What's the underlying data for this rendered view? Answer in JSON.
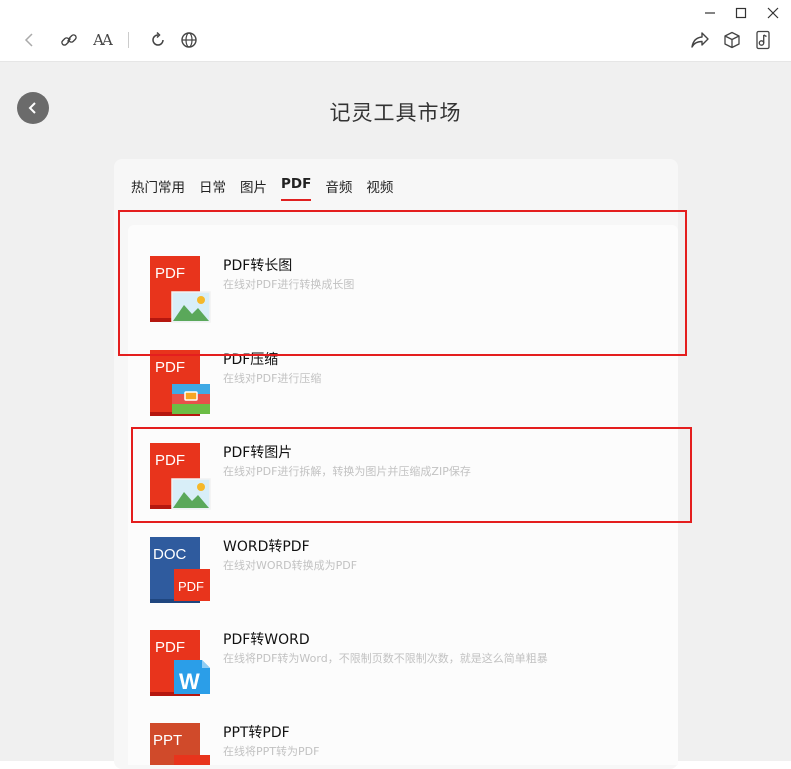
{
  "window": {
    "controls": [
      "minimize-icon",
      "maximize-icon",
      "close-icon"
    ]
  },
  "toolbar": {
    "font_size_label": "AA"
  },
  "page": {
    "title": "记灵工具市场"
  },
  "tabs": [
    {
      "label": "热门常用",
      "active": false
    },
    {
      "label": "日常",
      "active": false
    },
    {
      "label": "图片",
      "active": false
    },
    {
      "label": "PDF",
      "active": true
    },
    {
      "label": "音频",
      "active": false
    },
    {
      "label": "视频",
      "active": false
    }
  ],
  "tools": [
    {
      "title": "PDF转长图",
      "desc": "在线对PDF进行转换成长图",
      "icon_text": "PDF",
      "icon": "pdf-to-image-icon"
    },
    {
      "title": "PDF压缩",
      "desc": "在线对PDF进行压缩",
      "icon_text": "PDF",
      "icon": "pdf-compress-icon"
    },
    {
      "title": "PDF转图片",
      "desc": "在线对PDF进行拆解，转换为图片并压缩成ZIP保存",
      "icon_text": "PDF",
      "icon": "pdf-to-image-icon"
    },
    {
      "title": "WORD转PDF",
      "desc": "在线对WORD转换成为PDF",
      "icon_text": "DOC",
      "badge_text": "PDF",
      "icon": "word-to-pdf-icon"
    },
    {
      "title": "PDF转WORD",
      "desc": "在线将PDF转为Word，不限制页数不限制次数，就是这么简单粗暴",
      "icon_text": "PDF",
      "badge_text": "W",
      "icon": "pdf-to-word-icon"
    },
    {
      "title": "PPT转PDF",
      "desc": "在线将PPT转为PDF",
      "icon_text": "PPT",
      "icon": "ppt-to-pdf-icon"
    }
  ],
  "colors": {
    "accent_red": "#e41e1e",
    "pdf_red": "#e8341c",
    "doc_blue": "#2f5b9e",
    "background": "#f0f0f0"
  }
}
